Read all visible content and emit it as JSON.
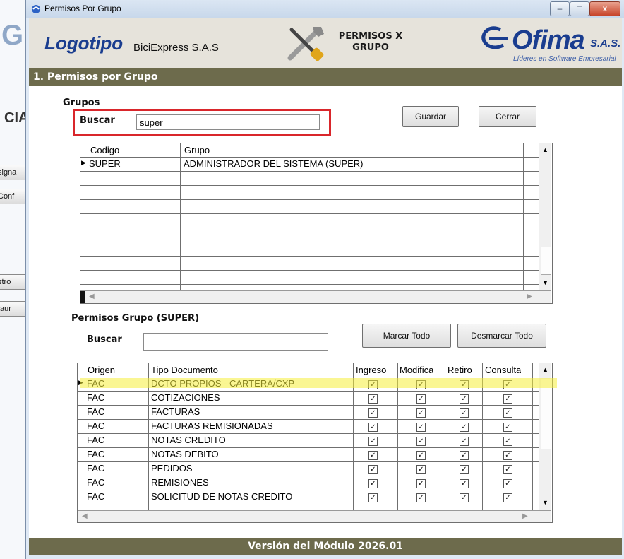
{
  "background": {
    "fragments": [
      "CIA"
    ],
    "buttons": [
      "signa",
      "Conf",
      "stro",
      "taur"
    ]
  },
  "window": {
    "title": "Permisos Por Grupo",
    "minimize_glyph": "–",
    "maximize_glyph": "□",
    "close_glyph": "x"
  },
  "header": {
    "logo": "Logotipo",
    "company": "BiciExpress S.A.S",
    "module_title_line1": "PERMISOS X",
    "module_title_line2": "GRUPO",
    "ofima": "Ofima",
    "ofima_suffix": "S.A.S.",
    "ofima_tagline": "Líderes en Software Empresarial"
  },
  "section_title": "1. Permisos por Grupo",
  "grupos": {
    "label": "Grupos",
    "search_label": "Buscar",
    "search_value": "super",
    "save_button": "Guardar",
    "close_button": "Cerrar",
    "columns": [
      "Codigo",
      "Grupo"
    ],
    "rows": [
      {
        "codigo": "SUPER",
        "grupo": "ADMINISTRADOR DEL SISTEMA (SUPER)"
      }
    ]
  },
  "permisos": {
    "label": "Permisos Grupo (SUPER)",
    "search_label": "Buscar",
    "search_value": "",
    "mark_all_button": "Marcar Todo",
    "unmark_all_button": "Desmarcar Todo",
    "columns": [
      "Origen",
      "Tipo Documento",
      "Ingreso",
      "Modifica",
      "Retiro",
      "Consulta"
    ],
    "rows": [
      {
        "origen": "FAC",
        "tipo": "DCTO PROPIOS - CARTERA/CXP",
        "ingreso": true,
        "modifica": true,
        "retiro": true,
        "consulta": true
      },
      {
        "origen": "FAC",
        "tipo": "COTIZACIONES",
        "ingreso": true,
        "modifica": true,
        "retiro": true,
        "consulta": true
      },
      {
        "origen": "FAC",
        "tipo": "FACTURAS",
        "ingreso": true,
        "modifica": true,
        "retiro": true,
        "consulta": true
      },
      {
        "origen": "FAC",
        "tipo": "FACTURAS REMISIONADAS",
        "ingreso": true,
        "modifica": true,
        "retiro": true,
        "consulta": true
      },
      {
        "origen": "FAC",
        "tipo": "NOTAS CREDITO",
        "ingreso": true,
        "modifica": true,
        "retiro": true,
        "consulta": true
      },
      {
        "origen": "FAC",
        "tipo": "NOTAS DEBITO",
        "ingreso": true,
        "modifica": true,
        "retiro": true,
        "consulta": true
      },
      {
        "origen": "FAC",
        "tipo": "PEDIDOS",
        "ingreso": true,
        "modifica": true,
        "retiro": true,
        "consulta": true
      },
      {
        "origen": "FAC",
        "tipo": "REMISIONES",
        "ingreso": true,
        "modifica": true,
        "retiro": true,
        "consulta": true
      },
      {
        "origen": "FAC",
        "tipo": "SOLICITUD DE NOTAS CREDITO",
        "ingreso": true,
        "modifica": true,
        "retiro": true,
        "consulta": true
      }
    ]
  },
  "footer": "Versión del Módulo 2026.01",
  "colors": {
    "section_bar": "#6d6b4c",
    "highlight_search": "#d9262b",
    "highlight_row": "#f5ef3a",
    "brand_blue": "#1a3d8f"
  }
}
